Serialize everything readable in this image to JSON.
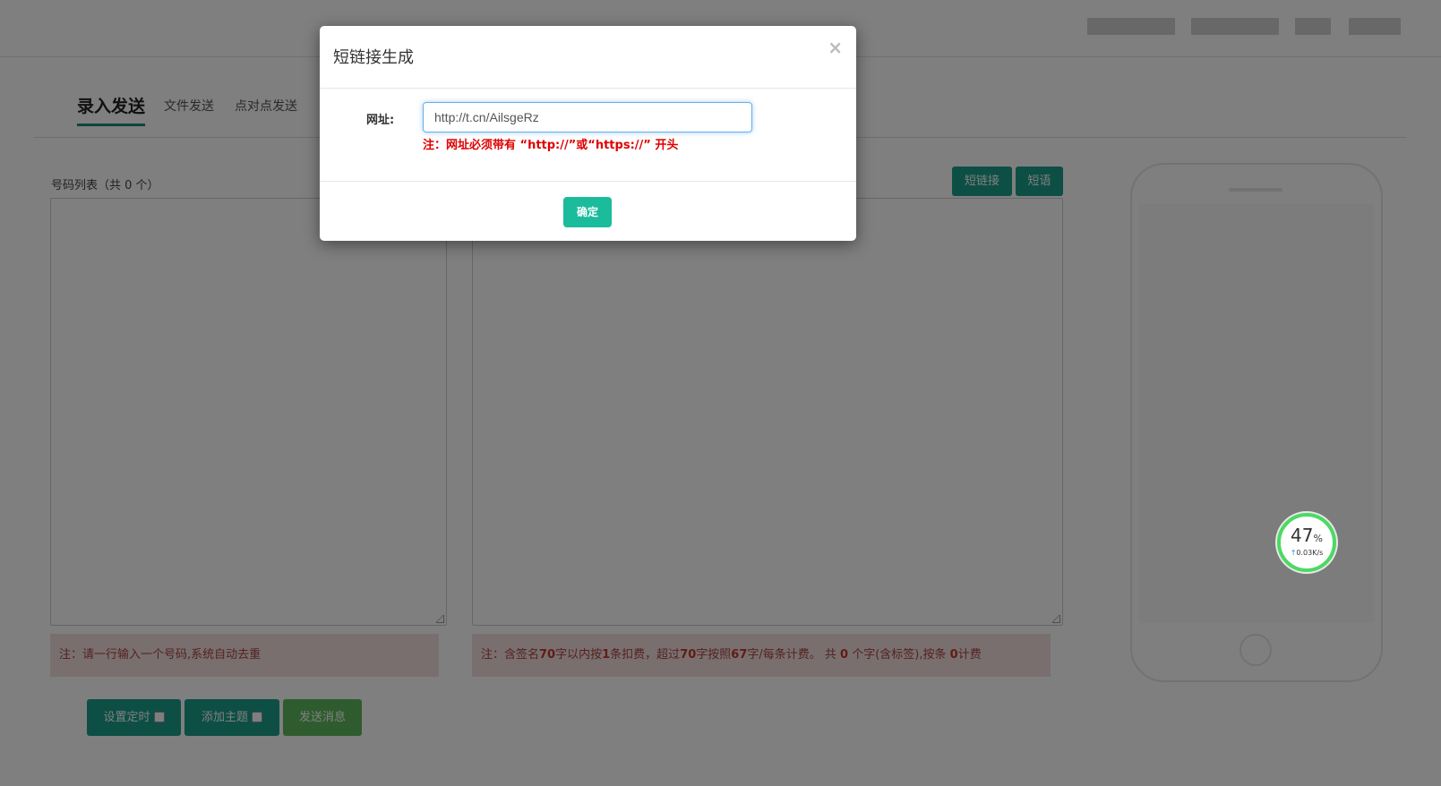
{
  "tabs": [
    {
      "label": "录入发送",
      "active": true
    },
    {
      "label": "文件发送",
      "active": false
    },
    {
      "label": "点对点发送",
      "active": false
    }
  ],
  "numbers": {
    "label": "号码列表（共 0 个）",
    "note": "注：请一行输入一个号码,系统自动去重"
  },
  "content": {
    "short_link_button": "短链接",
    "short_phrase_button": "短语",
    "note": {
      "p1": "注：含签名",
      "n1": "70",
      "p2": "字以内按",
      "n2": "1",
      "p3": "条扣费，超过",
      "n3": "70",
      "p4": "字按照",
      "n4": "67",
      "p5": "字/每条计费。 共 ",
      "n5": "0",
      "p6": " 个字(含标签),按条 ",
      "n6": "0",
      "p7": "计费"
    }
  },
  "actions": {
    "schedule": "设置定时",
    "add_subject": "添加主题",
    "send": "发送消息"
  },
  "speed_widget": {
    "percent": "47",
    "percent_unit": "%",
    "rate": "0.03K/s"
  },
  "modal": {
    "title": "短链接生成",
    "close": "×",
    "url_label": "网址:",
    "url_value": "http://t.cn/AilsgeRz",
    "hint": "注：网址必须带有 “http://”或“https://” 开头",
    "confirm": "确定"
  },
  "colors": {
    "accent": "#1a9e8a",
    "confirm": "#1abc9c",
    "send": "#5cb85c",
    "hint": "#e00000"
  }
}
